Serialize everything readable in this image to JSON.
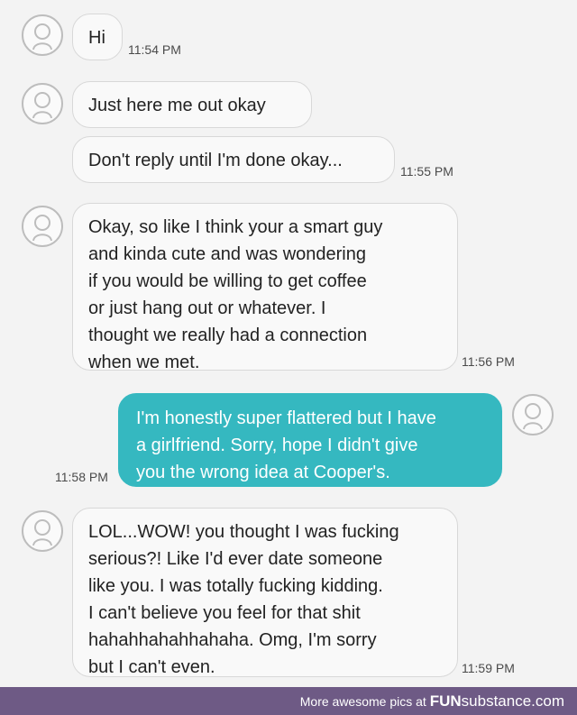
{
  "messages": [
    {
      "direction": "incoming",
      "lines": [
        "Hi"
      ],
      "time": "11:54 PM"
    },
    {
      "direction": "incoming",
      "lines": [
        "Just here me out okay"
      ],
      "time": ""
    },
    {
      "direction": "incoming",
      "lines": [
        "Don't reply until I'm done okay..."
      ],
      "time": "11:55 PM"
    },
    {
      "direction": "incoming",
      "lines": [
        "Okay, so like I think your a smart guy",
        "and kinda cute and was wondering",
        "if you would be willing to get coffee",
        "or just hang out or whatever. I",
        "thought we really had a connection",
        "when we met."
      ],
      "time": "11:56 PM"
    },
    {
      "direction": "outgoing",
      "lines": [
        "I'm honestly super flattered but I have",
        "a girlfriend. Sorry, hope I didn't give",
        "you the wrong idea at Cooper's."
      ],
      "time": "11:58 PM"
    },
    {
      "direction": "incoming",
      "lines": [
        "LOL...WOW! you thought I was fucking",
        "serious?! Like I'd ever date someone",
        "like you. I was totally fucking kidding.",
        "I can't believe you feel for that shit",
        "hahahhahahhahaha. Omg, I'm sorry",
        "but I can't even."
      ],
      "time": "11:59 PM"
    }
  ],
  "footer": {
    "text": "More awesome pics at",
    "brand_bold": "FUN",
    "brand_regular": "substance.com"
  },
  "colors": {
    "outgoing_bubble": "#35b8c0",
    "incoming_bubble": "#f9f9f9",
    "footer_bg": "#6e5a85"
  }
}
